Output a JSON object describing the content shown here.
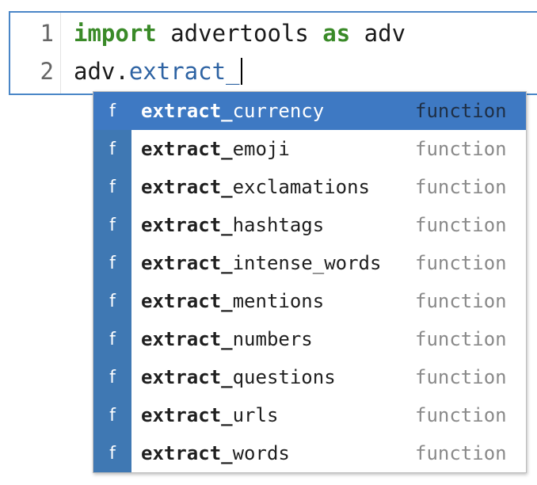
{
  "editor": {
    "line_numbers": [
      "1",
      "2"
    ],
    "line1": {
      "kw_import": "import",
      "module": " advertools ",
      "kw_as": "as",
      "alias": " adv"
    },
    "line2": {
      "prefix": "adv.",
      "typed": "extract_"
    }
  },
  "completer": {
    "items": [
      {
        "icon": "f",
        "match": "extract_",
        "rest": "currency",
        "kind": "function",
        "selected": true
      },
      {
        "icon": "f",
        "match": "extract_",
        "rest": "emoji",
        "kind": "function"
      },
      {
        "icon": "f",
        "match": "extract_",
        "rest": "exclamations",
        "kind": "function"
      },
      {
        "icon": "f",
        "match": "extract_",
        "rest": "hashtags",
        "kind": "function"
      },
      {
        "icon": "f",
        "match": "extract_",
        "rest": "intense_words",
        "kind": "function"
      },
      {
        "icon": "f",
        "match": "extract_",
        "rest": "mentions",
        "kind": "function"
      },
      {
        "icon": "f",
        "match": "extract_",
        "rest": "numbers",
        "kind": "function"
      },
      {
        "icon": "f",
        "match": "extract_",
        "rest": "questions",
        "kind": "function"
      },
      {
        "icon": "f",
        "match": "extract_",
        "rest": "urls",
        "kind": "function"
      },
      {
        "icon": "f",
        "match": "extract_",
        "rest": "words",
        "kind": "function"
      }
    ]
  },
  "colors": {
    "cell_border": "#4a86c7",
    "keyword": "#3a8a28",
    "attribute": "#2e63a3",
    "selection": "#3e79c3",
    "icon_bg": "#3f78b3"
  }
}
